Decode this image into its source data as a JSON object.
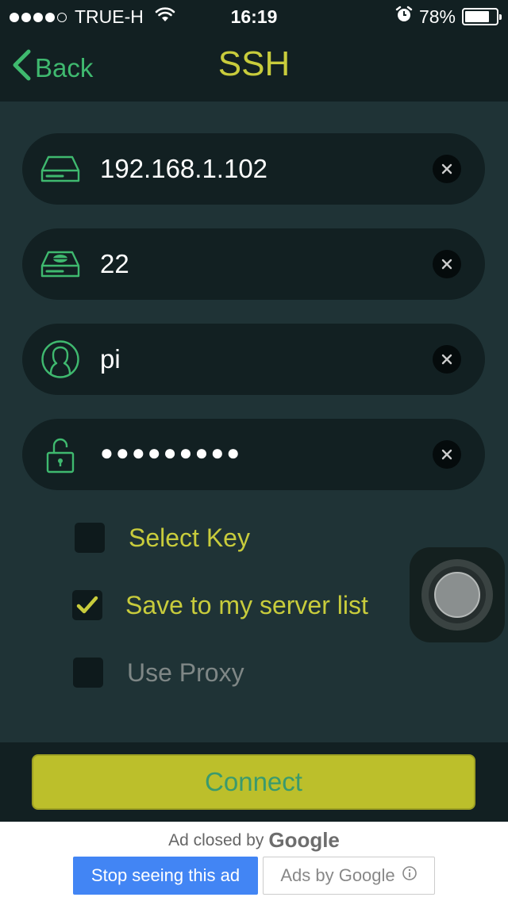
{
  "status": {
    "carrier": "TRUE-H",
    "time": "16:19",
    "battery": "78%",
    "battery_level": 0.78
  },
  "nav": {
    "back_label": "Back",
    "title": "SSH"
  },
  "fields": {
    "host": {
      "value": "192.168.1.102",
      "icon": "server-icon"
    },
    "port": {
      "value": "22",
      "icon": "drive-icon"
    },
    "user": {
      "value": "pi",
      "icon": "user-icon"
    },
    "password": {
      "value": "●●●●●●●●●",
      "icon": "lock-open-icon"
    }
  },
  "options": {
    "select_key": {
      "label": "Select Key",
      "checked": false
    },
    "save_list": {
      "label": "Save to my server list",
      "checked": true
    },
    "use_proxy": {
      "label": "Use Proxy",
      "checked": false
    }
  },
  "connect_label": "Connect",
  "ad": {
    "closed_by": "Ad closed by",
    "google": "Google",
    "stop_label": "Stop seeing this ad",
    "ads_by_label": "Ads by Google"
  },
  "colors": {
    "accent_green": "#3fb96f",
    "accent_yellow": "#c8cc3c",
    "background": "#1f3336",
    "bar": "#122022"
  }
}
